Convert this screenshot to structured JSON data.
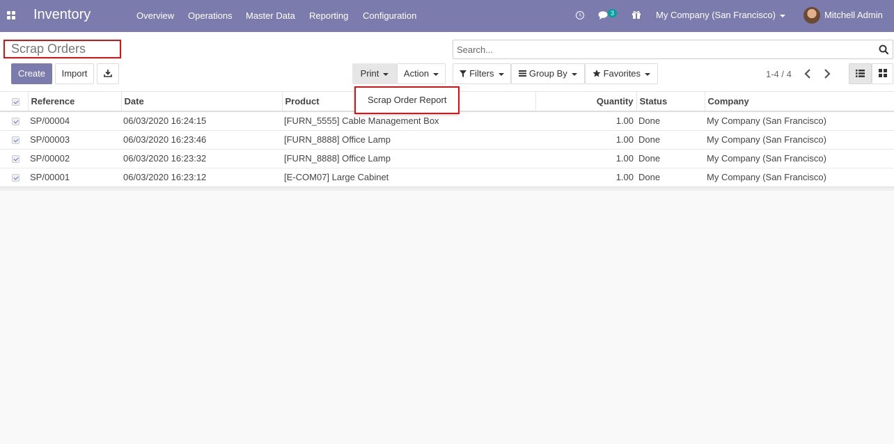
{
  "navbar": {
    "brand": "Inventory",
    "menu": [
      "Overview",
      "Operations",
      "Master Data",
      "Reporting",
      "Configuration"
    ],
    "notification_count": "3",
    "company": "My Company (San Francisco)",
    "user": "Mitchell Admin"
  },
  "control": {
    "title": "Scrap Orders",
    "search_placeholder": "Search...",
    "create_label": "Create",
    "import_label": "Import",
    "print_label": "Print",
    "action_label": "Action",
    "filters_label": "Filters",
    "groupby_label": "Group By",
    "favorites_label": "Favorites",
    "pager": "1-4 / 4"
  },
  "print_menu": {
    "items": [
      "Scrap Order Report"
    ]
  },
  "table": {
    "columns": [
      "Reference",
      "Date",
      "Product",
      "Quantity",
      "Status",
      "Company"
    ],
    "rows": [
      [
        "SP/00004",
        "06/03/2020 16:24:15",
        "[FURN_5555] Cable Management Box",
        "1.00",
        "Done",
        "My Company (San Francisco)"
      ],
      [
        "SP/00003",
        "06/03/2020 16:23:46",
        "[FURN_8888] Office Lamp",
        "1.00",
        "Done",
        "My Company (San Francisco)"
      ],
      [
        "SP/00002",
        "06/03/2020 16:23:32",
        "[FURN_8888] Office Lamp",
        "1.00",
        "Done",
        "My Company (San Francisco)"
      ],
      [
        "SP/00001",
        "06/03/2020 16:23:12",
        "[E-COM07] Large Cabinet",
        "1.00",
        "Done",
        "My Company (San Francisco)"
      ]
    ]
  },
  "colors": {
    "brand": "#7c7bad",
    "highlight": "#e01010",
    "badge": "#00a09d"
  },
  "icons": {
    "apps": "apps-grid-icon",
    "clock": "clock-icon",
    "chat": "chat-icon",
    "gift": "gift-icon",
    "download": "download-icon",
    "search": "search-icon",
    "list_view": "list-view-icon",
    "kanban_view": "kanban-view-icon"
  }
}
